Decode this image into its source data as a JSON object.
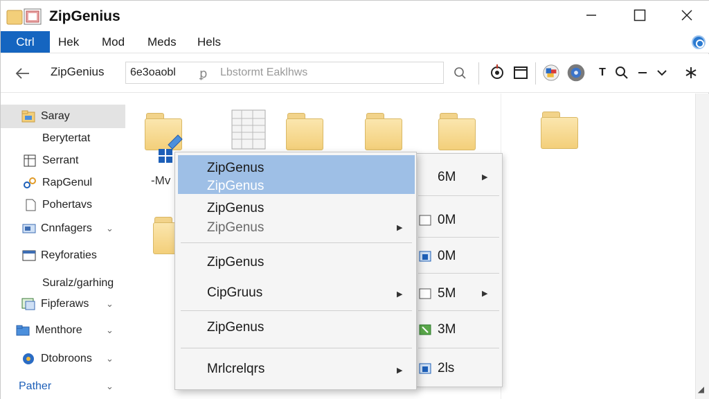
{
  "window": {
    "title": "ZipGenius",
    "controls": {
      "minimize": "minimize",
      "maximize": "maximize",
      "close": "close"
    }
  },
  "menubar": {
    "items": [
      {
        "label": "Ctrl",
        "active": true
      },
      {
        "label": "Hek"
      },
      {
        "label": "Mod"
      },
      {
        "label": "Meds"
      },
      {
        "label": "Hels"
      }
    ]
  },
  "toolbar": {
    "breadcrumb": "ZipGenius",
    "address_value": "6e3oaobl",
    "search_glyph": "ꝑ",
    "search_placeholder": "Lbstormt Eaklhws",
    "icons": [
      "refresh-icon",
      "target-icon",
      "window-icon",
      "colorful-badge-icon",
      "disc-icon",
      "text-icon",
      "zoom-icon",
      "minus-icon",
      "chevron-down-icon",
      "asterisk-icon"
    ],
    "text_icon_label": "T"
  },
  "sidebar": {
    "items": [
      {
        "label": "Saray",
        "icon": "folder-icon",
        "selected": true
      },
      {
        "label": "Berytertat",
        "icon": ""
      },
      {
        "label": "Serrant",
        "icon": "document-grid-icon"
      },
      {
        "label": "RapGenul",
        "icon": "link-icon"
      },
      {
        "label": "Pohertavs",
        "icon": "page-icon"
      },
      {
        "label": "Cnnfagers",
        "icon": "drive-icon",
        "expandable": true
      },
      {
        "label": "Reyforaties",
        "icon": "window-icon"
      },
      {
        "label": "Suralz/garhing",
        "icon": ""
      },
      {
        "label": "Fipferaws",
        "icon": "image-icon",
        "expandable": true
      },
      {
        "label": "Menthore",
        "icon": "folder-blue-icon",
        "expandable": true
      },
      {
        "label": "Dtobroons",
        "icon": "shield-icon",
        "expandable": true
      },
      {
        "label": "Pather",
        "icon": "",
        "expandable": true
      }
    ]
  },
  "content": {
    "file_label": "-Mv"
  },
  "context_menu": {
    "items": [
      {
        "label": "ZipGenus",
        "sub": "ZipGenus",
        "highlight": true
      },
      {
        "label": "ZipGenus",
        "sub": "ZipGenus",
        "has_submenu": true
      },
      {
        "label": "ZipGenus"
      },
      {
        "label": "CipGruus",
        "has_submenu": true
      },
      {
        "label": "ZipGenus"
      },
      {
        "label": "Mrlcrelqrs",
        "has_submenu": true
      }
    ]
  },
  "submenu": {
    "rows": [
      {
        "label": "6M",
        "has_arrow": true
      },
      {
        "label": "0M"
      },
      {
        "label": "0M"
      },
      {
        "label": "5M",
        "has_arrow": true
      },
      {
        "label": "3M"
      },
      {
        "label": "2ls"
      }
    ]
  },
  "colors": {
    "accent": "#1565c0",
    "highlight": "#9ebfe6",
    "folder": "#f3cf7a"
  }
}
